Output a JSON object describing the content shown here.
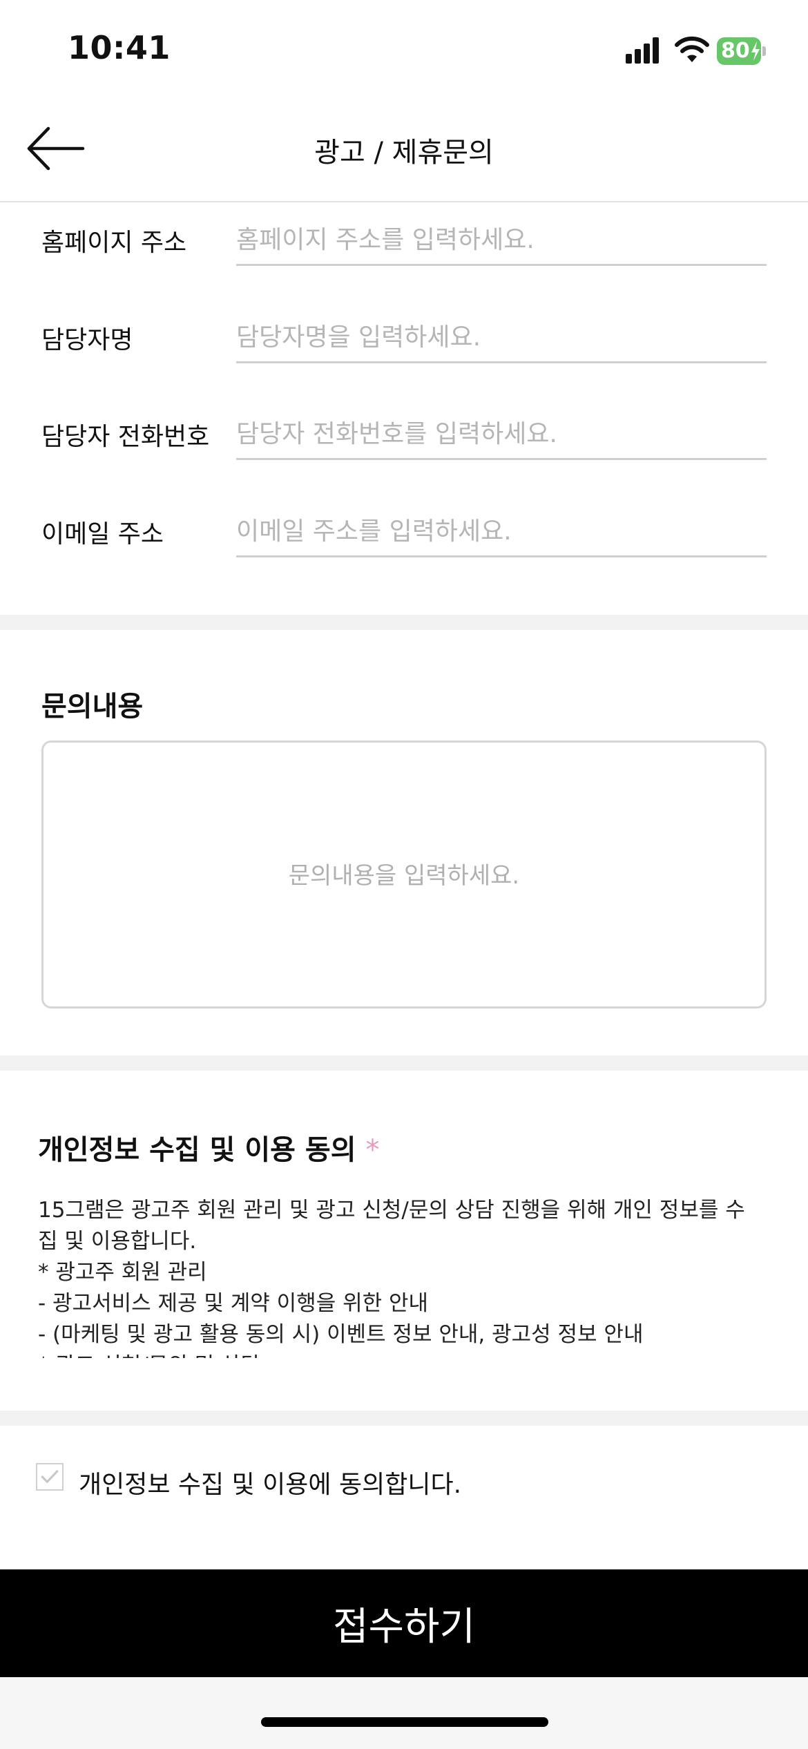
{
  "status_bar": {
    "time": "10:41",
    "battery": "80",
    "icons": [
      "signal-icon",
      "wifi-icon",
      "battery-charging-icon"
    ]
  },
  "header": {
    "back_icon": "arrow-left-icon",
    "title": "광고 / 제휴문의"
  },
  "form": {
    "fields": [
      {
        "label": "홈페이지 주소",
        "placeholder": "홈페이지 주소를 입력하세요.",
        "value": ""
      },
      {
        "label": "담당자명",
        "placeholder": "담당자명을 입력하세요.",
        "value": ""
      },
      {
        "label": "담당자 전화번호",
        "placeholder": "담당자 전화번호를 입력하세요.",
        "value": ""
      },
      {
        "label": "이메일 주소",
        "placeholder": "이메일 주소를 입력하세요.",
        "value": ""
      }
    ]
  },
  "inquiry": {
    "title": "문의내용",
    "placeholder": "문의내용을 입력하세요."
  },
  "privacy": {
    "title": "개인정보 수집 및 이용 동의",
    "required_mark": "*",
    "lines": [
      "15그램은 광고주 회원 관리 및 광고 신청/문의 상담 진행을 위해 개인 정보를 수",
      "집 및 이용합니다.",
      "* 광고주 회원 관리",
      "- 광고서비스 제공 및 계약 이행을 위한 안내",
      "- (마케팅 및 광고 활용 동의 시) 이벤트 정보 안내, 광고성 정보 안내",
      "* 광고 신청/문의 및 상담"
    ]
  },
  "agreement": {
    "label": "개인정보 수집 및 이용에 동의합니다.",
    "checked": false,
    "check_icon": "checkmark-icon"
  },
  "submit": {
    "label": "접수하기"
  },
  "colors": {
    "primary_button": "#000000",
    "required_star": "#e79ac0",
    "battery": "#67c768",
    "divider": "#f2f2f2"
  }
}
